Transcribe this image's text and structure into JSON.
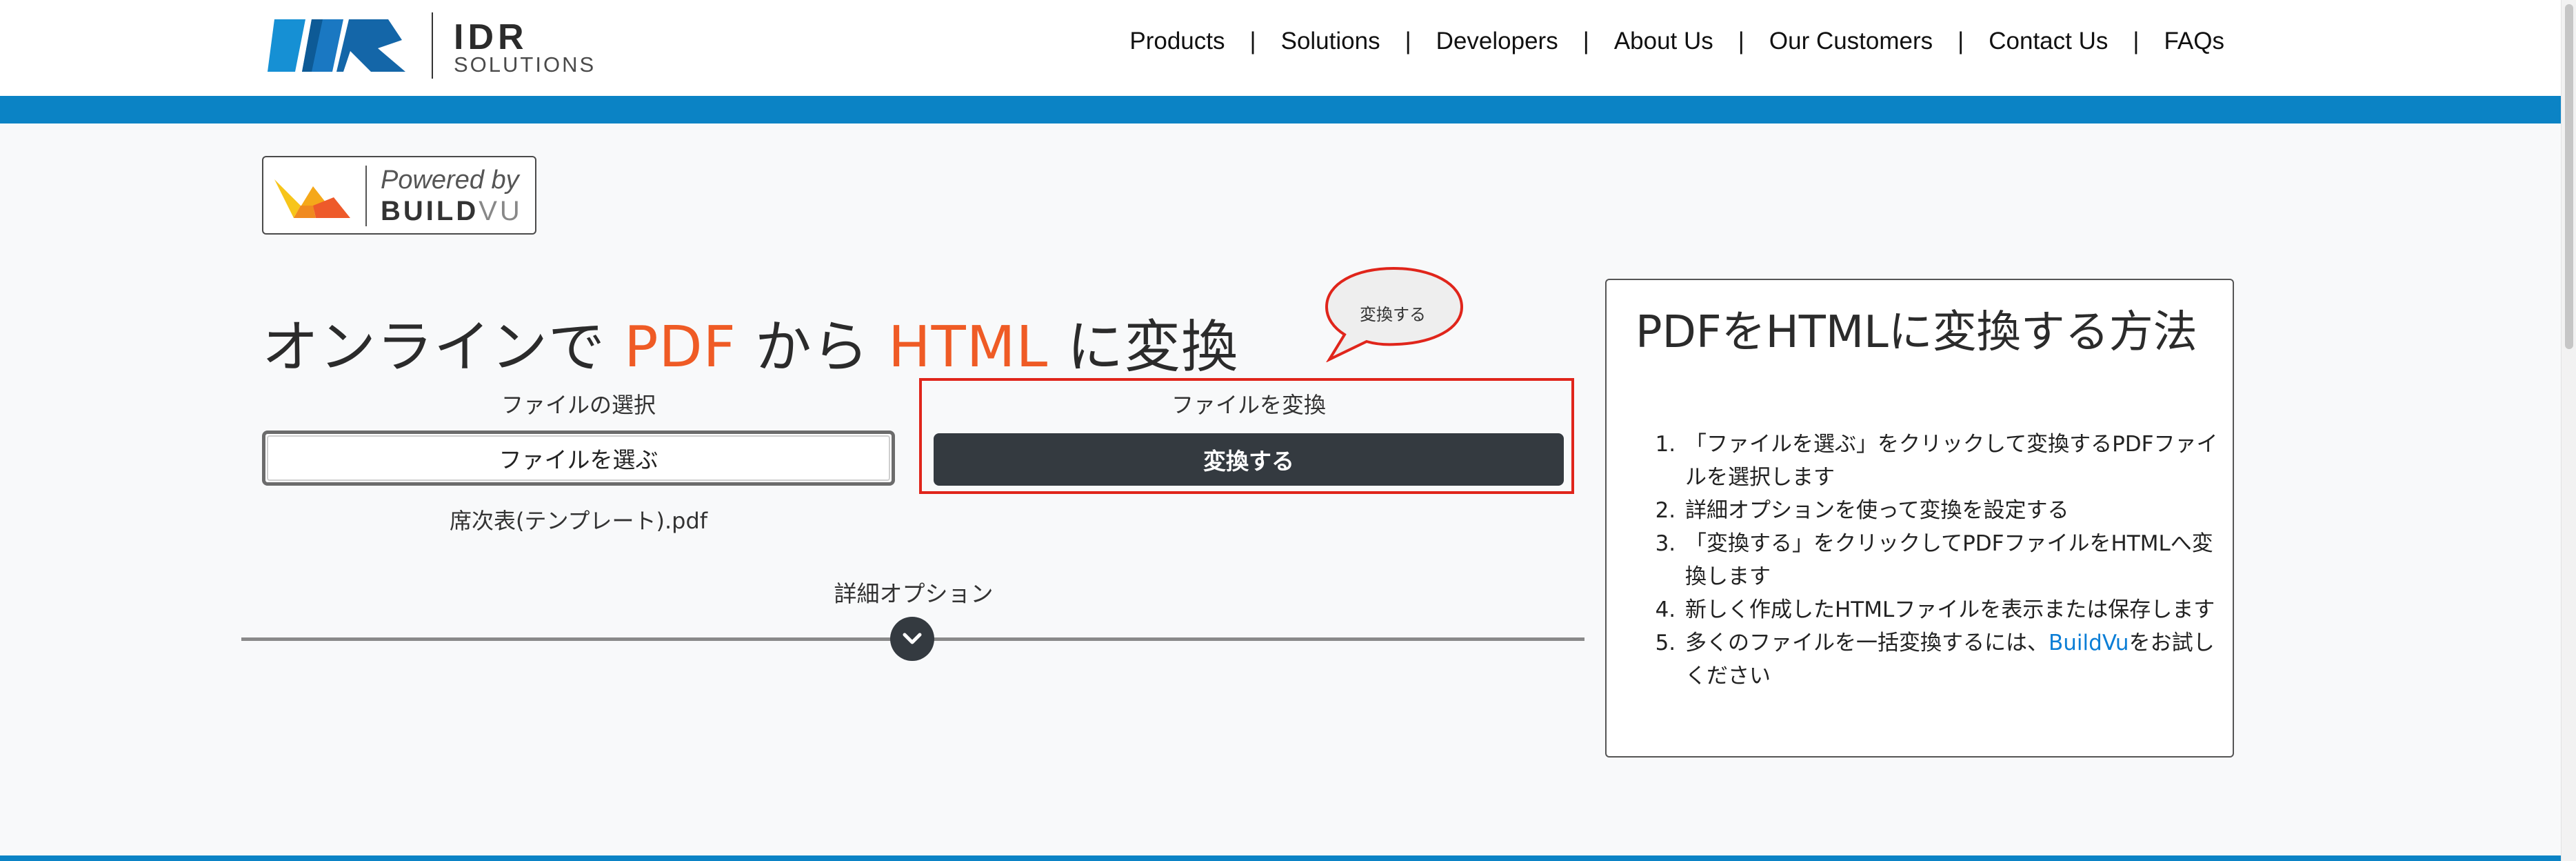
{
  "header": {
    "logo_main": "IDR",
    "logo_sub": "SOLUTIONS",
    "nav": [
      "Products",
      "Solutions",
      "Developers",
      "About Us",
      "Our Customers",
      "Contact Us",
      "FAQs"
    ],
    "separator": "|"
  },
  "powered": {
    "line1": "Powered by",
    "line2_bold": "BUILD",
    "line2_light": "VU"
  },
  "title": {
    "part1": "オンラインで ",
    "pdf": "PDF",
    "part2": " から ",
    "html": "HTML",
    "part3": " に変換"
  },
  "bubble": {
    "text": "変換する"
  },
  "select": {
    "label": "ファイルの選択",
    "button": "ファイルを選ぶ",
    "filename": "席次表(テンプレート).pdf"
  },
  "convert": {
    "label": "ファイルを変換",
    "button": "変換する"
  },
  "detail": {
    "label": "詳細オプション"
  },
  "howto": {
    "title": "PDFをHTMLに変換する方法",
    "steps": [
      "「ファイルを選ぶ」をクリックして変換するPDFファイルを選択します",
      "詳細オプションを使って変換を設定する",
      "「変換する」をクリックしてPDFファイルをHTMLへ変換します",
      "新しく作成したHTMLファイルを表示または保存します"
    ],
    "step5_before": "多くのファイルを一括変換するには、",
    "step5_link": "BuildVu",
    "step5_after": "をお試しください"
  },
  "colors": {
    "brand_blue": "#0b83c5",
    "accent_orange": "#ef5b25",
    "highlight_red": "#e0251b",
    "dark_button": "#343a40"
  }
}
